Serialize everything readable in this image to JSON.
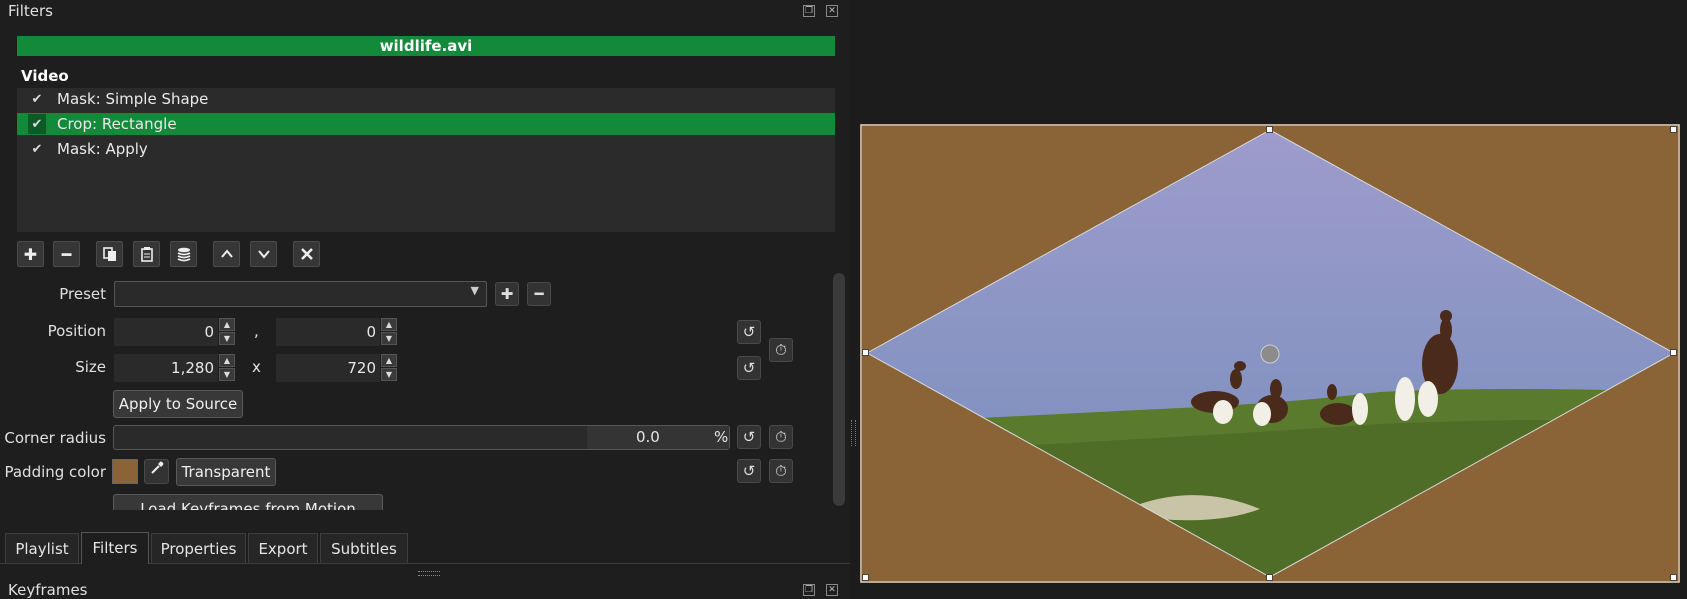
{
  "filters_dock": {
    "title": "Filters",
    "clip_name": "wildlife.avi",
    "section_label": "Video",
    "filters": [
      {
        "label": "Mask: Simple Shape",
        "checked": true,
        "selected": false
      },
      {
        "label": "Crop: Rectangle",
        "checked": true,
        "selected": true
      },
      {
        "label": "Mask: Apply",
        "checked": true,
        "selected": false
      }
    ],
    "toolbar_icons": [
      "plus-icon",
      "minus-icon",
      "copy-icon",
      "paste-icon",
      "stack-icon",
      "chevron-up-icon",
      "chevron-down-icon",
      "close-icon"
    ]
  },
  "properties": {
    "preset_label": "Preset",
    "preset_value": "",
    "position_label": "Position",
    "position_x": "0",
    "position_sep": ",",
    "position_y": "0",
    "size_label": "Size",
    "size_w": "1,280",
    "size_sep": "x",
    "size_h": "720",
    "apply_to_source_label": "Apply to Source",
    "corner_radius_label": "Corner radius",
    "corner_radius_value": "0.0",
    "corner_radius_unit": "%",
    "padding_color_label": "Padding color",
    "padding_color": "#8a6336",
    "transparent_label": "Transparent",
    "load_keyframes_label": "Load Keyframes from Motion Tracker"
  },
  "tabs": [
    {
      "label": "Playlist",
      "active": false
    },
    {
      "label": "Filters",
      "active": true
    },
    {
      "label": "Properties",
      "active": false
    },
    {
      "label": "Export",
      "active": false
    },
    {
      "label": "Subtitles",
      "active": false
    }
  ],
  "keyframes_dock": {
    "title": "Keyframes"
  },
  "colors": {
    "accent_green": "#13893a",
    "panel_bg": "#1e1e1e",
    "list_bg": "#2b2b2b",
    "padding_brown": "#8a6336"
  }
}
